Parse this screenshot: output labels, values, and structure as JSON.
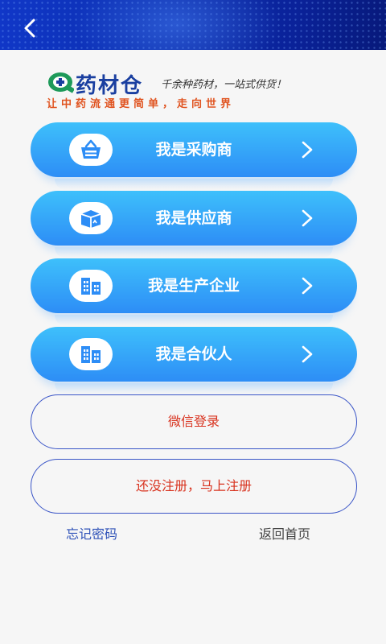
{
  "brand": {
    "name": "药材仓",
    "slogan_main": "千余种药材，一站式供货！",
    "slogan_sub": "让中药流通更简单，走向世界"
  },
  "roles": [
    {
      "label": "我是采购商",
      "icon": "basket-icon"
    },
    {
      "label": "我是供应商",
      "icon": "box-icon"
    },
    {
      "label": "我是生产企业",
      "icon": "building-icon"
    },
    {
      "label": "我是合伙人",
      "icon": "building-icon"
    }
  ],
  "wechat_login": "微信登录",
  "register": "还没注册，马上注册",
  "forgot_password": "忘记密码",
  "back_home": "返回首页",
  "colors": {
    "header": "#0c2fb0",
    "button_gradient_top": "#3ec0fb",
    "button_gradient_bottom": "#2d8df6",
    "outline_border": "#3a55c7",
    "outline_text": "#d8321e",
    "brand": "#1a3fa0",
    "slogan_sub": "#e0531f"
  }
}
